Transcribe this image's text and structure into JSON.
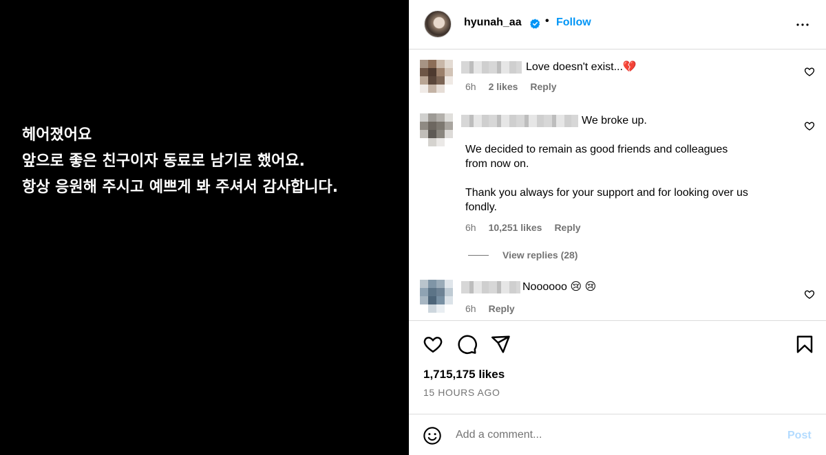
{
  "post": {
    "lines": [
      "헤어졌어요",
      "앞으로 좋은 친구이자 동료로 남기로 했어요.",
      "항상 응원해 주시고 예쁘게 봐 주셔서 감사합니다."
    ]
  },
  "header": {
    "username": "hyunah_aa",
    "separator": "•",
    "follow_label": "Follow",
    "more_icon": "more-horizontal-icon"
  },
  "comments": [
    {
      "text": "Love doesn't exist...💔",
      "time": "6h",
      "likes": "2 likes",
      "reply": "Reply"
    },
    {
      "text": "We broke up.",
      "body": "We decided to remain as good friends and colleagues\nfrom now on.\n\nThank you always for your support and for looking over us\nfondly.",
      "time": "6h",
      "likes": "10,251 likes",
      "reply": "Reply",
      "view_replies": "View replies (28)"
    },
    {
      "text": "Noooooo 😢 😢",
      "time": "6h",
      "reply": "Reply"
    }
  ],
  "actions": {
    "like_icon": "heart-icon",
    "comment_icon": "comment-icon",
    "share_icon": "send-icon",
    "save_icon": "bookmark-icon"
  },
  "stats": {
    "likes": "1,715,175 likes",
    "time_ago": "15 HOURS AGO"
  },
  "add_comment": {
    "placeholder": "Add a comment...",
    "post_label": "Post"
  },
  "colors": {
    "accent": "#0095f6",
    "muted": "#737373",
    "post_disabled": "#b3dbff",
    "image_bg": "#000000"
  }
}
